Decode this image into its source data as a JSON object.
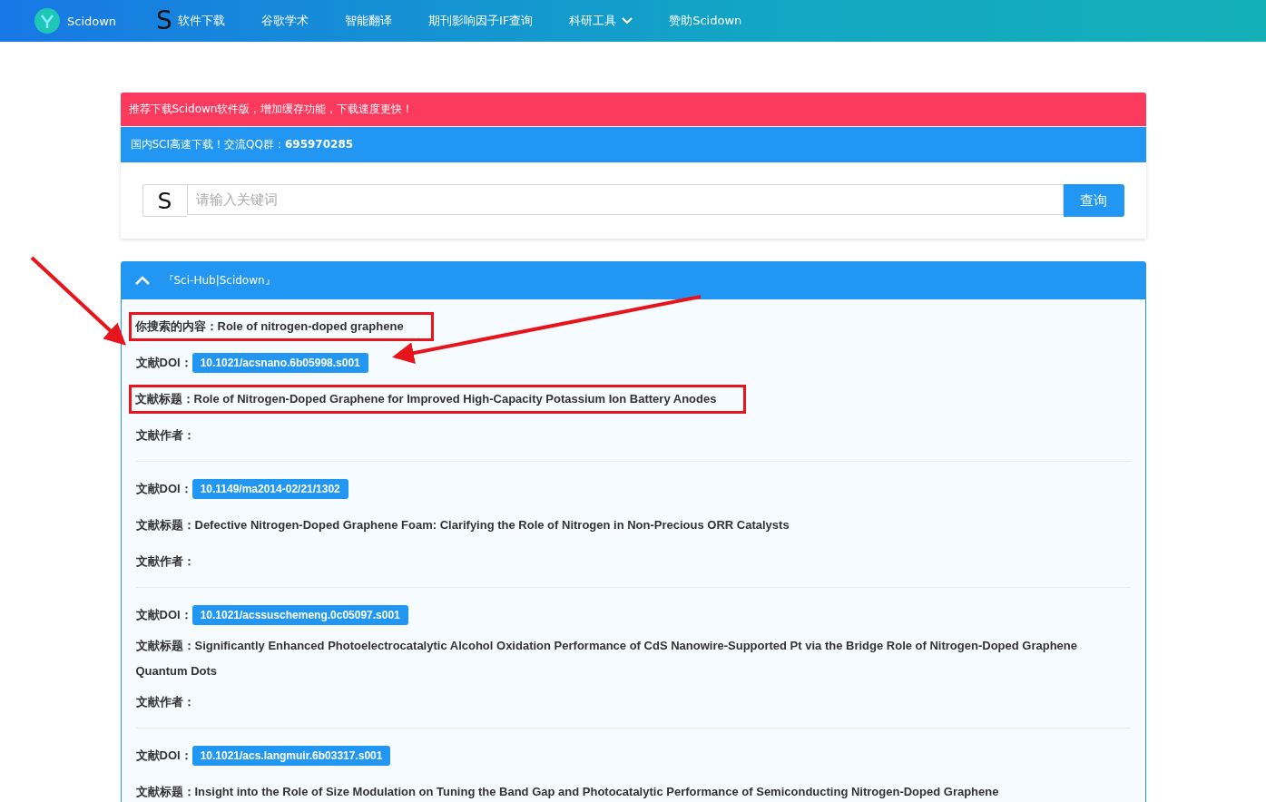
{
  "nav": {
    "brand": "Scidown",
    "items": [
      {
        "kind": "logo",
        "logo_letter": "S",
        "label": "软件下载"
      },
      {
        "kind": "link",
        "label": "谷歌学术"
      },
      {
        "kind": "link",
        "label": "智能翻译"
      },
      {
        "kind": "link",
        "label": "期刊影响因子IF查询"
      },
      {
        "kind": "dropdown",
        "label": "科研工具"
      },
      {
        "kind": "link",
        "label": "赞助Scidown"
      }
    ]
  },
  "alert_text": "推荐下载Scidown软件版，增加缓存功能，下载速度更快！",
  "search_card": {
    "title": "国内SCI高速下载！交流QQ群：**695970285**",
    "addon": "S",
    "placeholder": "请输入关键词",
    "button": "查询"
  },
  "results": {
    "title": "『Sci-Hub|Scidown』",
    "expanded": true,
    "query_label": "你搜索的内容：",
    "query": "Role of nitrogen-doped graphene",
    "query_highlighted": true,
    "records": [
      {
        "doi_label": "文献DOI：",
        "doi": "10.1021/acsnano.6b05998.s001",
        "title_label": "文献标题：",
        "title": "Role of Nitrogen-Doped Graphene for Improved High-Capacity Potassium Ion Battery Anodes",
        "author_label": "文献作者：",
        "title_highlighted": true,
        "doi_pointed": true
      },
      {
        "doi_label": "文献DOI：",
        "doi": "10.1149/ma2014-02/21/1302",
        "title_label": "文献标题：",
        "title": "Defective Nitrogen-Doped Graphene Foam: Clarifying the Role of Nitrogen in Non-Precious ORR Catalysts",
        "author_label": "文献作者：",
        "title_highlighted": false,
        "doi_pointed": false
      },
      {
        "doi_label": "文献DOI：",
        "doi": "10.1021/acssuschemeng.0c05097.s001",
        "title_label": "文献标题：",
        "title": "Significantly Enhanced Photoelectrocatalytic Alcohol Oxidation Performance of CdS Nanowire-Supported Pt via the Bridge Role of Nitrogen-Doped Graphene Quantum Dots",
        "author_label": "文献作者：",
        "title_highlighted": false,
        "doi_pointed": false
      },
      {
        "doi_label": "文献DOI：",
        "doi": "10.1021/acs.langmuir.6b03317.s001",
        "title_label": "文献标题：",
        "title": "Insight into the Role of Size Modulation on Tuning the Band Gap and Photocatalytic Performance of Semiconducting Nitrogen-Doped Graphene",
        "title_highlighted": false,
        "doi_pointed": false
      }
    ]
  }
}
